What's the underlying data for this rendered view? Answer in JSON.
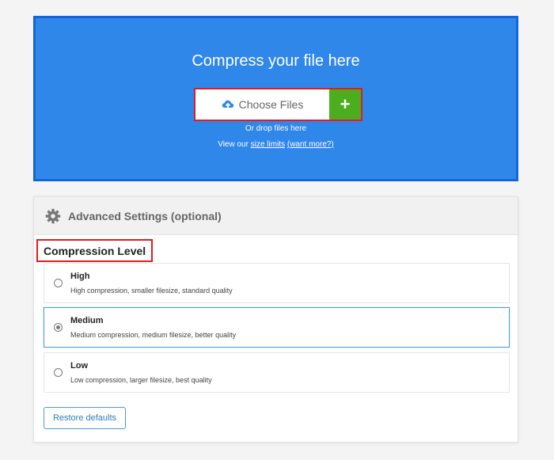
{
  "upload": {
    "title": "Compress your file here",
    "choose_label": "Choose Files",
    "add_label": "+",
    "drop_text": "Or drop files here",
    "limits_prefix": "View our",
    "size_limits_link": "size limits",
    "want_more_link": "(want more?)",
    "upload_icon": "cloud-upload-icon",
    "bg_color": "#2f87ea",
    "add_color": "#4cae1f"
  },
  "settings": {
    "gear_icon": "gear-icon",
    "title": "Advanced Settings (optional)",
    "level_label": "Compression Level",
    "options": [
      {
        "title": "High",
        "desc": "High compression, smaller filesize, standard quality",
        "selected": false
      },
      {
        "title": "Medium",
        "desc": "Medium compression, medium filesize, better quality",
        "selected": true
      },
      {
        "title": "Low",
        "desc": "Low compression, larger filesize, best quality",
        "selected": false
      }
    ],
    "restore_label": "Restore defaults"
  },
  "highlight_color": "#e01b22"
}
